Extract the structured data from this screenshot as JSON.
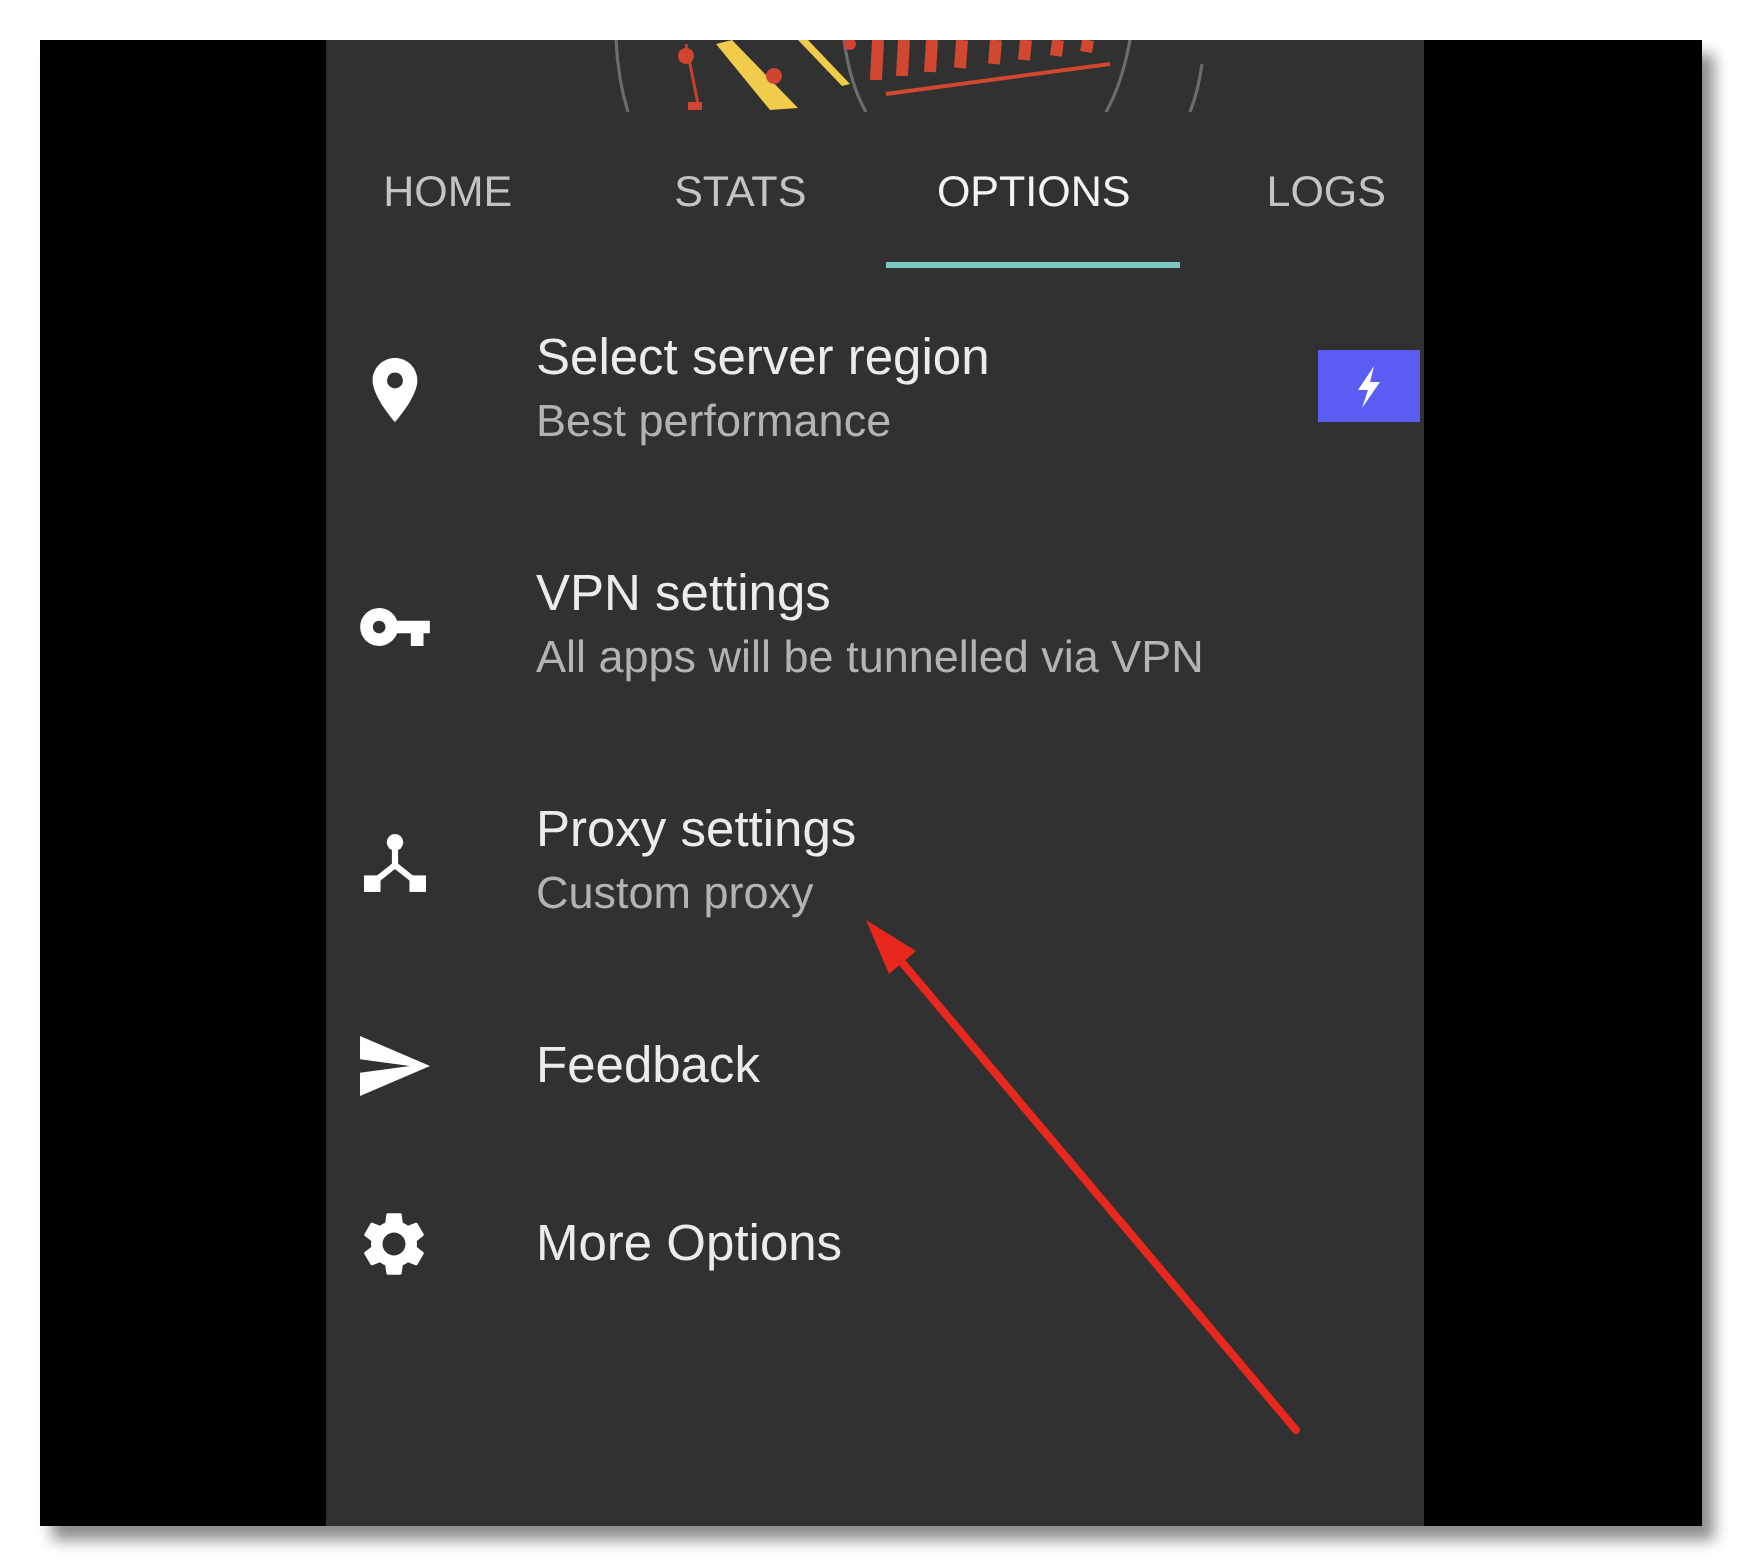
{
  "tabs": [
    {
      "label": "HOME",
      "selected": false
    },
    {
      "label": "STATS",
      "selected": false
    },
    {
      "label": "OPTIONS",
      "selected": true
    },
    {
      "label": "LOGS",
      "selected": false
    }
  ],
  "options": [
    {
      "title": "Select server region",
      "subtitle": "Best performance"
    },
    {
      "title": "VPN settings",
      "subtitle": "All apps will be tunnelled via VPN"
    },
    {
      "title": "Proxy settings",
      "subtitle": "Custom proxy"
    },
    {
      "title": "Feedback"
    },
    {
      "title": "More Options"
    }
  ]
}
